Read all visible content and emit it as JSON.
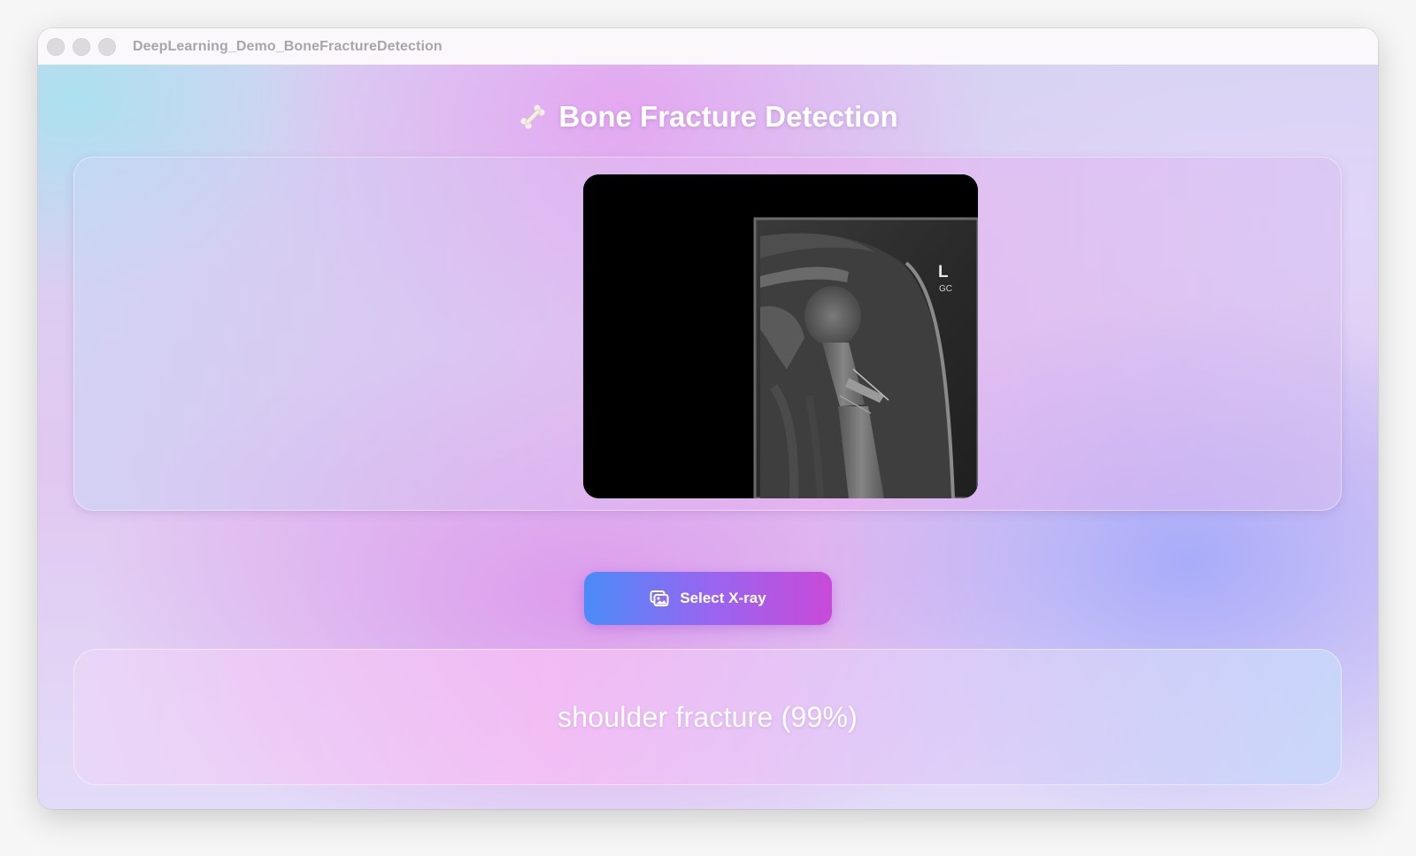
{
  "window": {
    "title": "DeepLearning_Demo_BoneFractureDetection"
  },
  "header": {
    "icon": "bone-icon",
    "title": "Bone Fracture Detection"
  },
  "image_panel": {
    "xray_marker_letter": "L",
    "xray_marker_initials": "GC"
  },
  "actions": {
    "select_icon": "photo-stack-icon",
    "select_label": "Select X-ray",
    "accent_start": "#4a8bf8",
    "accent_end": "#c94ad8"
  },
  "result": {
    "text": "shoulder fracture (99%)"
  }
}
